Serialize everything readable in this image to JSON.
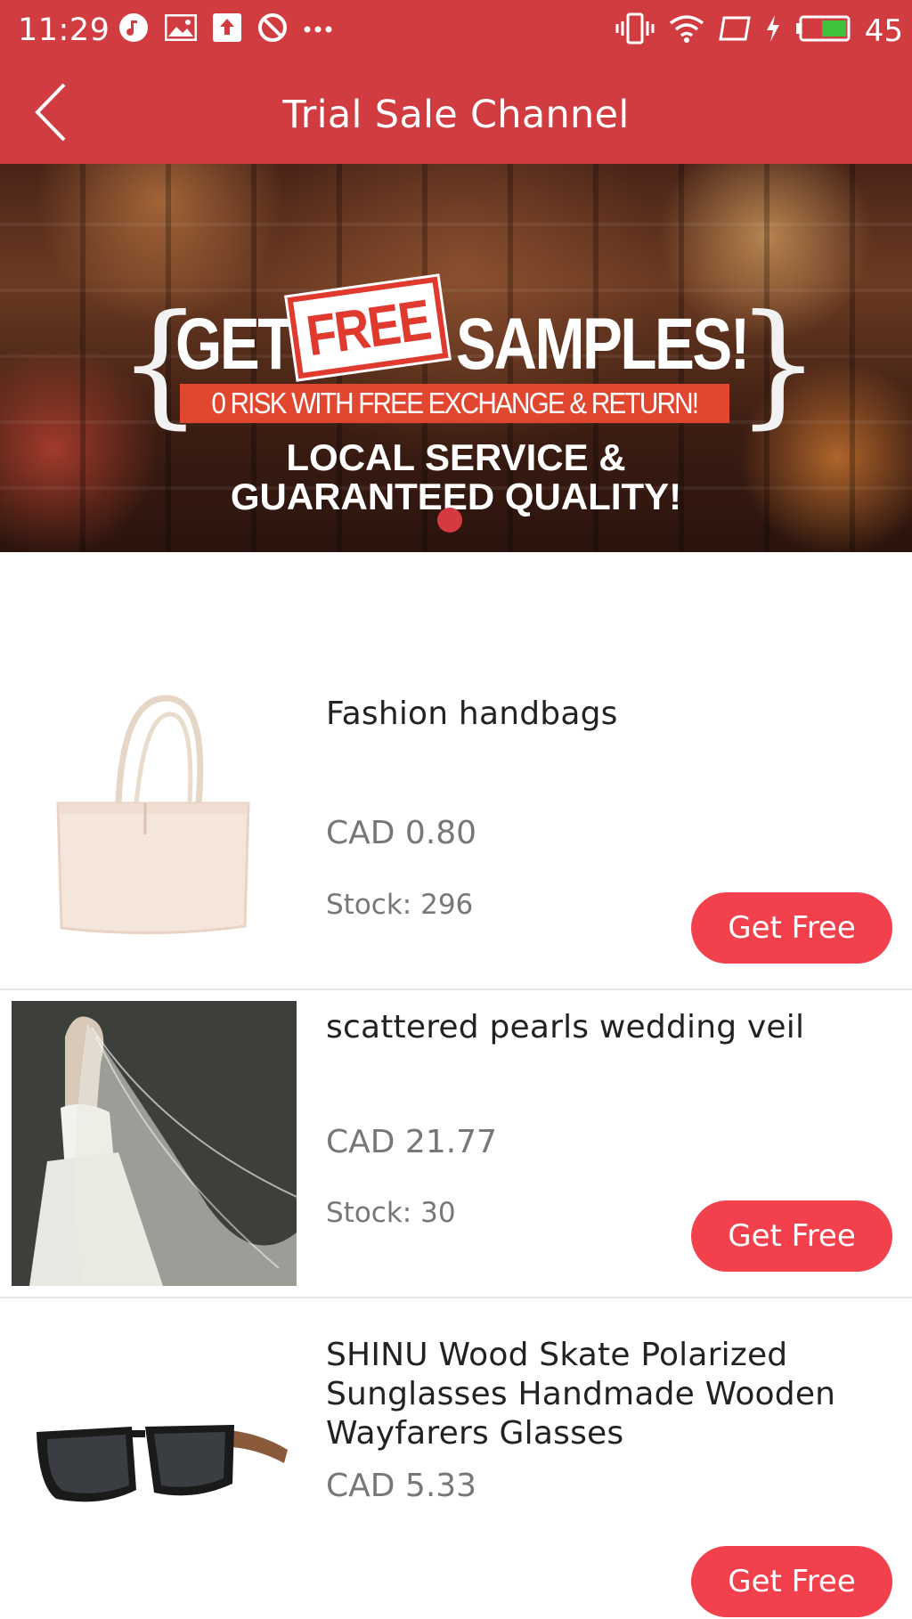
{
  "status_bar": {
    "time": "11:29",
    "battery_level": "45",
    "icons_left": [
      "music-icon",
      "image-icon",
      "upload-icon",
      "blocked-icon",
      "more-icon"
    ],
    "icons_right": [
      "vibrate-icon",
      "wifi-icon",
      "screen-icon",
      "charging-icon",
      "battery-icon"
    ]
  },
  "app_bar": {
    "title": "Trial Sale Channel",
    "background": "#d13c41"
  },
  "banner": {
    "line1_left": "GET",
    "stamp": "FREE",
    "line1_right": "SAMPLES!",
    "line2": "0 RISK WITH FREE EXCHANGE & RETURN!",
    "line3": "LOCAL SERVICE &",
    "line4": "GUARANTEED QUALITY!",
    "brace_left": "{",
    "brace_right": "}"
  },
  "products": [
    {
      "name": "Fashion handbags",
      "price": "CAD 0.80",
      "stock": "Stock: 296",
      "button": "Get Free"
    },
    {
      "name": " scattered pearls wedding veil",
      "price": "CAD 21.77",
      "stock": "Stock: 30",
      "button": "Get Free"
    },
    {
      "name": "SHINU Wood Skate Polarized Sunglasses Handmade Wooden Wayfarers Glasses",
      "price": "CAD 5.33",
      "stock": "",
      "button": "Get Free"
    }
  ],
  "colors": {
    "accent": "#d13c41",
    "button": "#f2414d",
    "price_text": "#777777"
  }
}
